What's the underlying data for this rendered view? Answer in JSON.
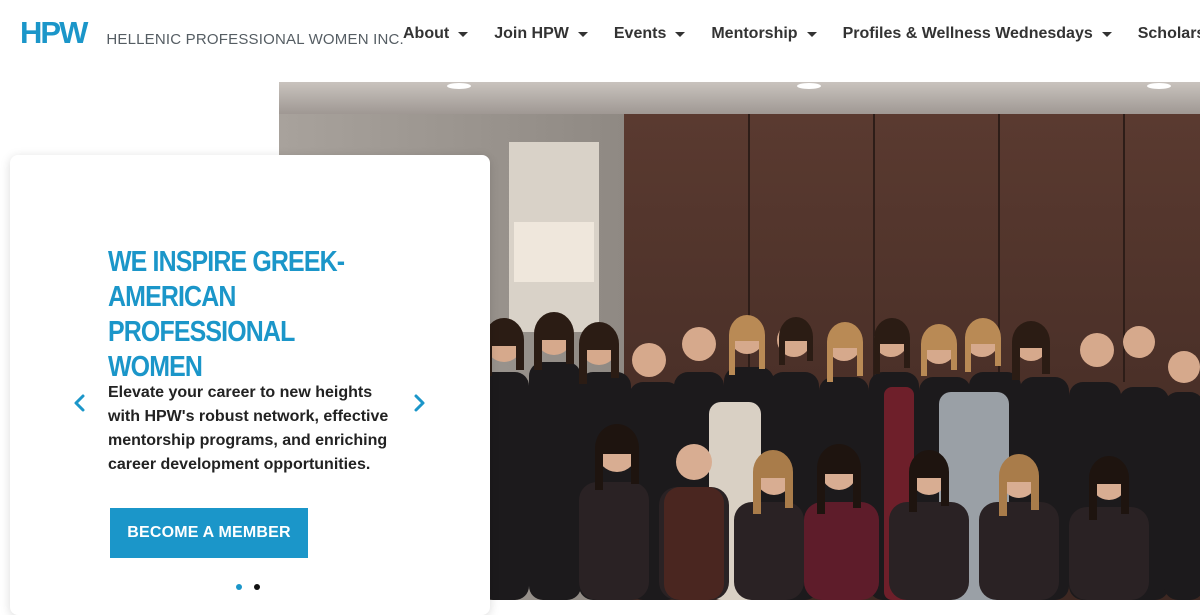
{
  "header": {
    "logo_mark": "HPW",
    "logo_text": "HELLENIC PROFESSIONAL WOMEN INC.",
    "nav": [
      {
        "label": "About"
      },
      {
        "label": "Join HPW"
      },
      {
        "label": "Events"
      },
      {
        "label": "Mentorship"
      },
      {
        "label": "Profiles & Wellness Wednesdays"
      },
      {
        "label": "Scholarship"
      }
    ]
  },
  "hero": {
    "headline": "WE INSPIRE GREEK-AMERICAN PROFESSIONAL WOMEN",
    "subtext": "Elevate your career to new heights with HPW's robust network, effective mentorship programs, and enriching career development opportunities.",
    "cta_label": "BECOME A MEMBER",
    "slides_total": 2,
    "active_slide": 1
  },
  "colors": {
    "accent": "#1b96c9",
    "text_dark": "#333333",
    "logo_gray": "#555d63"
  },
  "icons": {
    "prev": "chevron-left-icon",
    "next": "chevron-right-icon",
    "nav_caret": "caret-down-icon"
  }
}
